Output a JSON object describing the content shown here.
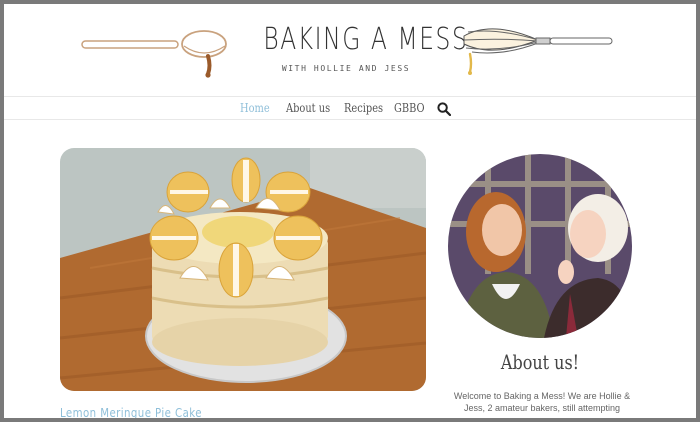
{
  "header": {
    "title": "BAKING A MESS",
    "subtitle": "WITH HOLLIE AND JESS"
  },
  "nav": {
    "items": [
      {
        "label": "Home",
        "active": true
      },
      {
        "label": "About us",
        "active": false
      },
      {
        "label": "Recipes",
        "active": false
      },
      {
        "label": "GBBO",
        "active": false
      }
    ],
    "search_icon": "search-icon"
  },
  "post": {
    "title": "Lemon Meringue Pie Cake",
    "image": "lemon meringue layer cake topped with macarons"
  },
  "sidebar": {
    "about_title": "About us!",
    "about_text": "Welcome to Baking a Mess! We are Hollie & Jess, 2 amateur bakers, still attempting"
  },
  "colors": {
    "accent": "#8fbfd9",
    "text": "#555555"
  }
}
